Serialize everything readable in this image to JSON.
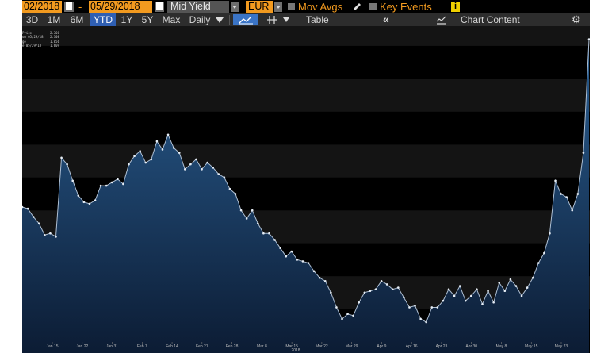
{
  "toolbar_top": {
    "start_date": "02/2018",
    "end_date": "05/29/2018",
    "date_separator": "-",
    "field": "Mid Yield",
    "currency": "EUR",
    "mov_avgs_label": "Mov Avgs",
    "key_events_label": "Key Events",
    "info_icon": "i"
  },
  "toolbar_bottom": {
    "periods": [
      "3D",
      "1M",
      "6M",
      "YTD",
      "1Y",
      "5Y",
      "Max"
    ],
    "active_period": "YTD",
    "frequency": "Daily",
    "table_label": "Table",
    "collapse_glyph": "«",
    "chart_content_label": "Chart Content",
    "gear_glyph": "⚙"
  },
  "legend": [
    {
      "label": "Price",
      "value": "2.308"
    },
    {
      "label": "on 05/29/18",
      "value": "2.308"
    },
    {
      "label": "ge",
      "value": "1.856"
    },
    {
      "label": "e 05/29/18",
      "value": "1.609"
    }
  ],
  "colors": {
    "accent_orange": "#f29a1f",
    "active_blue": "#2f5fb3",
    "area_top": "#2a5f93",
    "area_bottom": "#0c1c34",
    "line": "#aebfd3"
  },
  "chart_data": {
    "type": "area",
    "x_tick_labels": [
      "Jan 15",
      "Jan 22",
      "Jan 31",
      "Feb 7",
      "Feb 14",
      "Feb 21",
      "Feb 28",
      "Mar 8",
      "Mar 15",
      "Mar 22",
      "Mar 29",
      "Apr 9",
      "Apr 16",
      "Apr 23",
      "Apr 30",
      "May 8",
      "May 15",
      "May 23"
    ],
    "year_label": "2018",
    "y": [
      2.21,
      2.205,
      2.18,
      2.16,
      2.125,
      2.13,
      2.12,
      2.36,
      2.34,
      2.29,
      2.245,
      2.225,
      2.22,
      2.23,
      2.275,
      2.275,
      2.285,
      2.295,
      2.28,
      2.34,
      2.365,
      2.38,
      2.345,
      2.355,
      2.41,
      2.385,
      2.43,
      2.39,
      2.375,
      2.325,
      2.34,
      2.355,
      2.325,
      2.345,
      2.33,
      2.31,
      2.3,
      2.265,
      2.25,
      2.2,
      2.175,
      2.2,
      2.16,
      2.13,
      2.13,
      2.11,
      2.085,
      2.06,
      2.075,
      2.05,
      2.045,
      2.04,
      2.015,
      1.995,
      1.985,
      1.95,
      1.905,
      1.87,
      1.885,
      1.88,
      1.92,
      1.95,
      1.955,
      1.96,
      1.985,
      1.975,
      1.96,
      1.965,
      1.935,
      1.905,
      1.91,
      1.87,
      1.86,
      1.905,
      1.905,
      1.925,
      1.96,
      1.94,
      1.97,
      1.925,
      1.94,
      1.96,
      1.915,
      1.955,
      1.92,
      1.98,
      1.955,
      1.99,
      1.97,
      1.94,
      1.965,
      1.995,
      2.04,
      2.07,
      2.13,
      2.29,
      2.25,
      2.24,
      2.2,
      2.25,
      2.375,
      2.72
    ],
    "ylim": [
      1.8,
      2.76
    ],
    "grid": true
  }
}
